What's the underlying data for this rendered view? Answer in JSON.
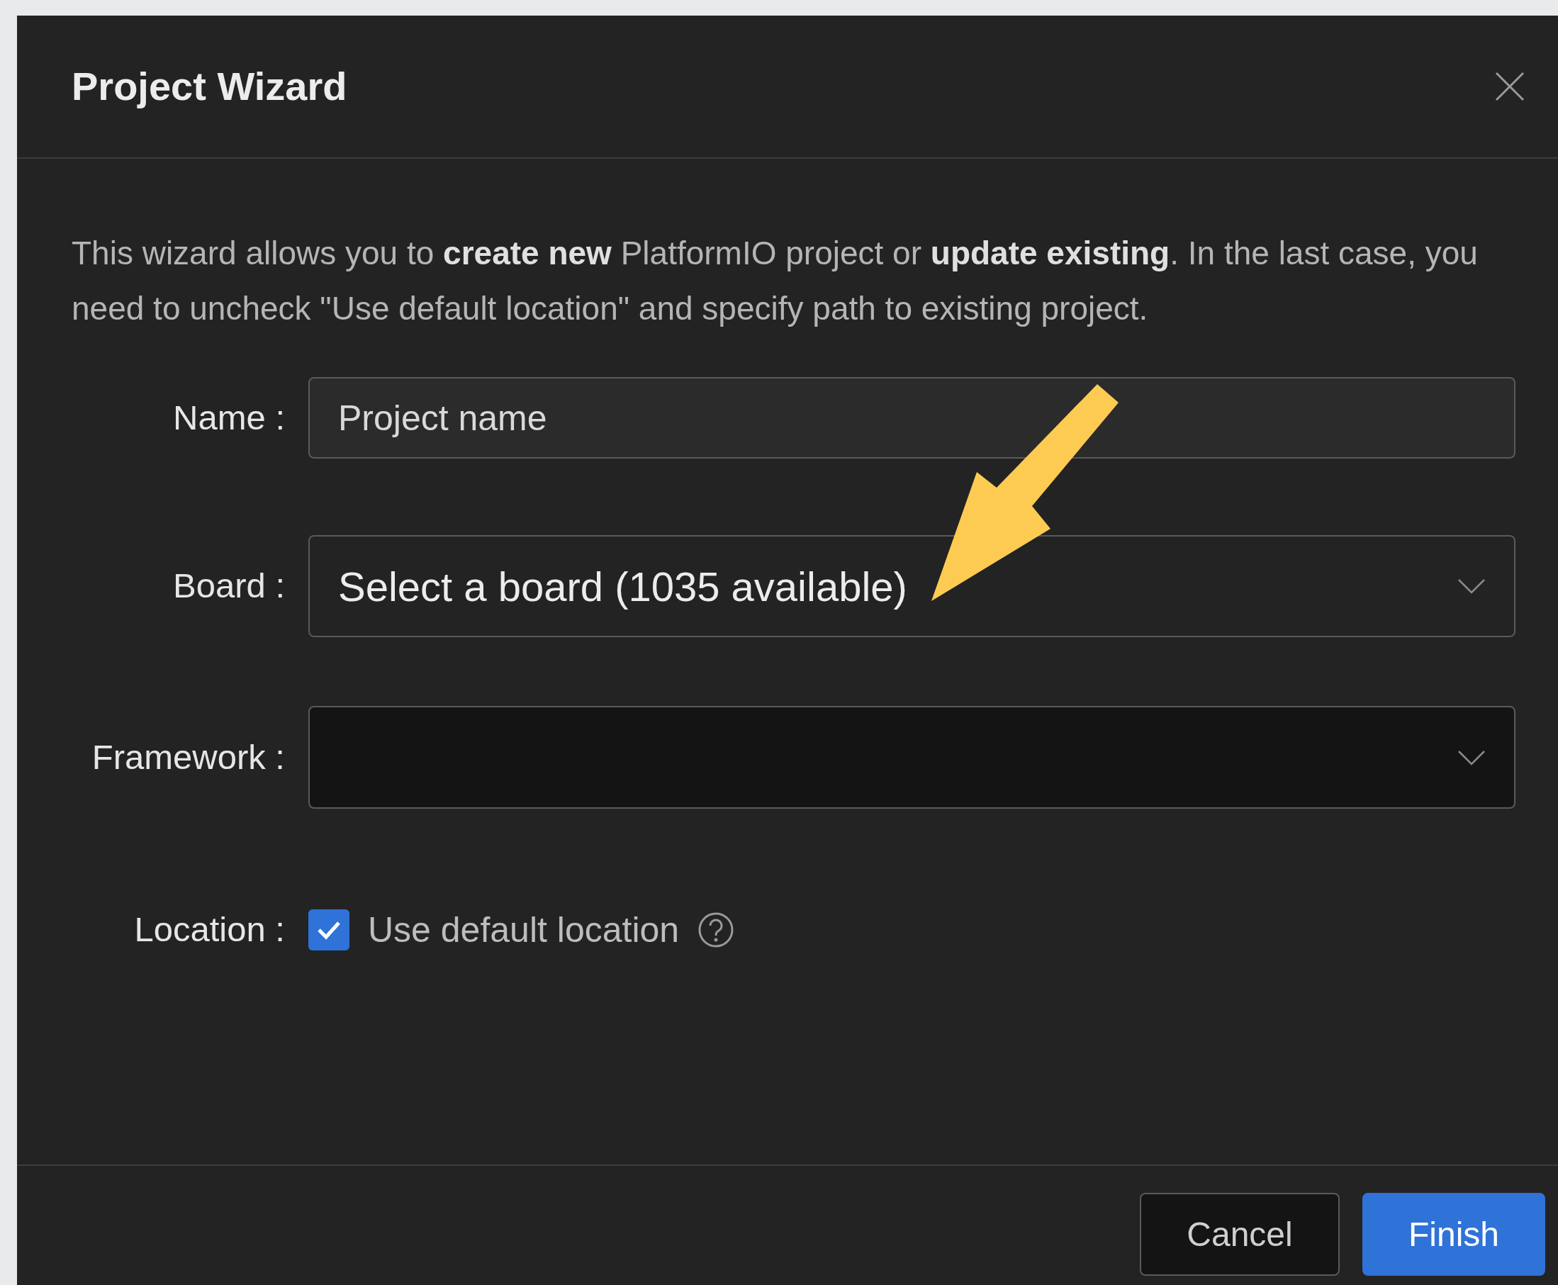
{
  "dialog": {
    "title": "Project Wizard"
  },
  "intro": "This wizard allows you to **create new** PlatformIO project or **update existing**. In the last case, you need to uncheck \"Use default location\" and specify path to existing project.",
  "fields": [
    {
      "kind": "text",
      "label": "Name :",
      "placeholder": "Project name"
    },
    {
      "kind": "select",
      "label": "Board :",
      "placeholder": "Select a board (1035 available)"
    },
    {
      "kind": "select",
      "label": "Framework :"
    },
    {
      "kind": "checkbox",
      "label": "Location :",
      "option": "Use default location",
      "checked": true
    }
  ],
  "buttons": [
    {
      "label": "Cancel",
      "kind": "secondary"
    },
    {
      "label": "Finish",
      "kind": "primary"
    }
  ]
}
